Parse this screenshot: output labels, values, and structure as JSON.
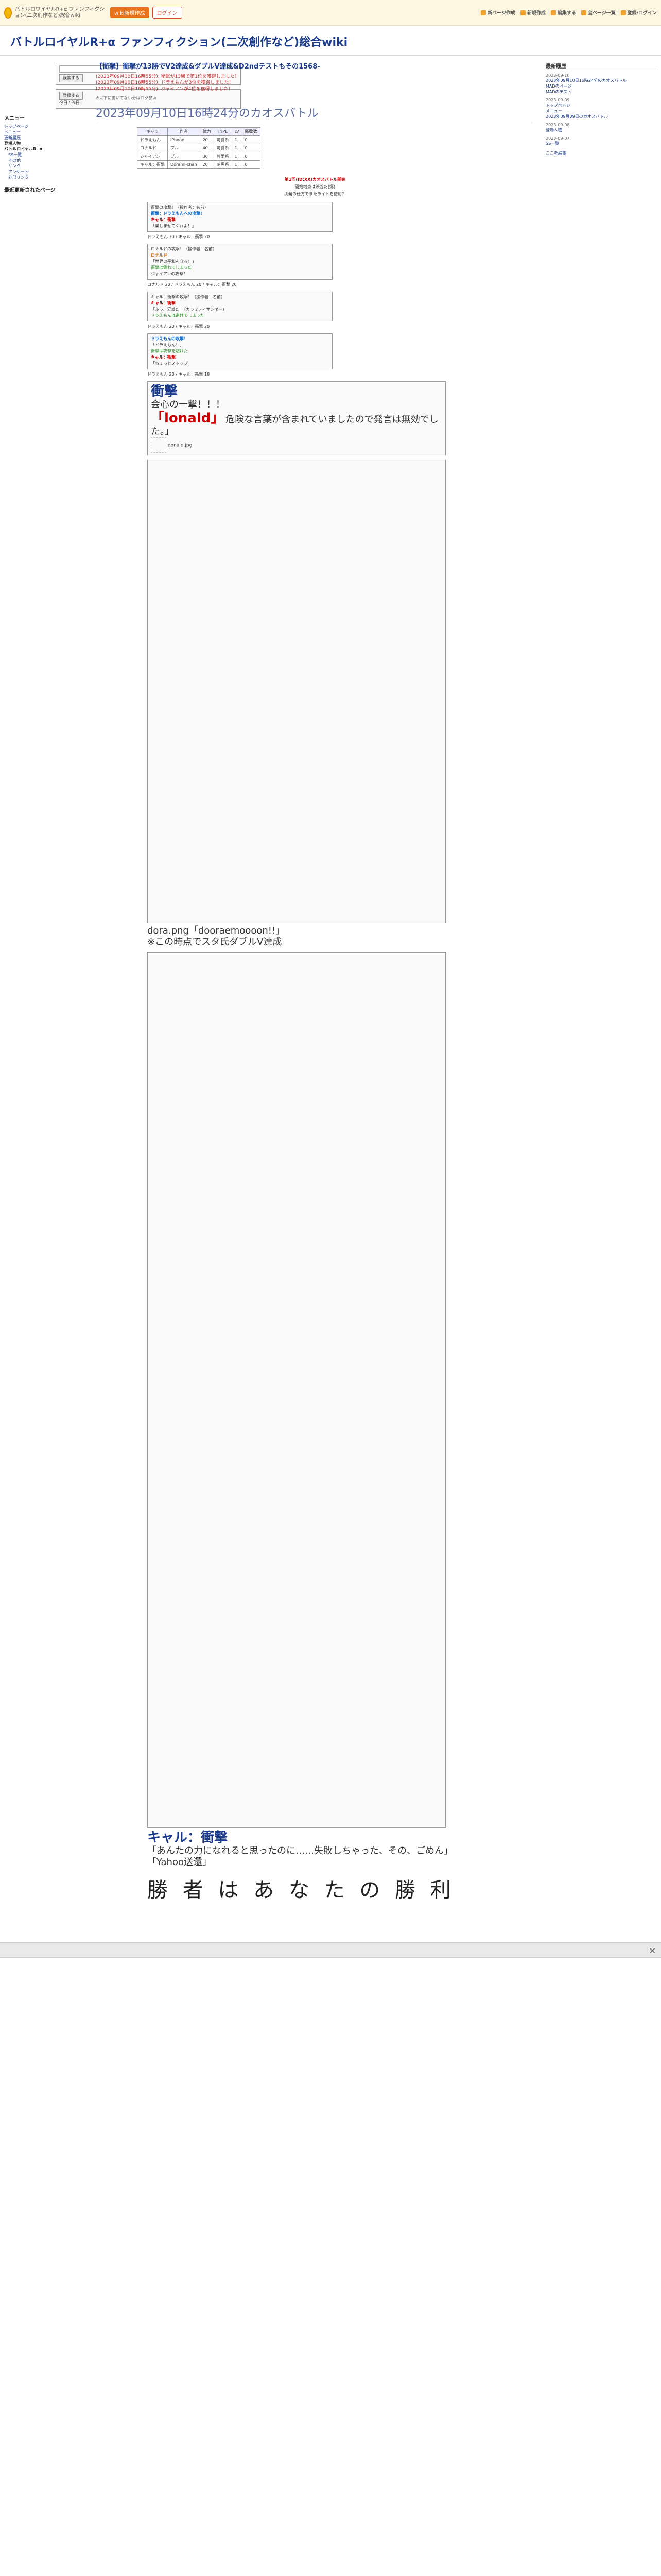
{
  "site": {
    "logo_text": "バトルロワイヤルR+α ファンフィクション(二次創作など)総合wiki",
    "btn_new": "wiki新規作成",
    "btn_login": "ログイン",
    "menu": [
      "新ページ作成",
      "新規作成",
      "編集する",
      "全ページ一覧",
      "登録/ログイン"
    ]
  },
  "wiki_title": "バトルロイヤルR+α ファンフィクション(二次創作など)総合wiki",
  "sidebar": {
    "search_placeholder": "",
    "search_btn": "検索する",
    "register_btn": "登録する",
    "today": "今日 / 昨日",
    "menu_title": "メニュー",
    "items": [
      "トップページ",
      "メニュー",
      "更新履歴",
      "登場人物",
      "バトルロイヤルR+α",
      "SS一覧",
      "その他",
      "リンク",
      "アンケート",
      "外部リンク"
    ],
    "recent_title": "最近更新されたページ"
  },
  "page": {
    "header": "【衝撃】衝撃が13勝でV2達成&ダブルV達成&D2ndテストもその1568-",
    "updates": [
      "(2023年09月10日16時55分): 衝撃が13勝で第1位を獲得しました！",
      "(2023年09月10日16時55分): ドラえもんが3位を獲得しました！",
      "(2023年09月10日16時55分): ジャイアンが4位を獲得しました！"
    ],
    "note": "※以下に書いてない分はログ参照",
    "big_title": "2023年09月10日16時24分のカオスバトル"
  },
  "stats": {
    "headers": [
      "キャラ",
      "作者",
      "体力",
      "TYPE",
      "LV",
      "勝敗数"
    ],
    "rows": [
      [
        "ドラえもん",
        "iPhone",
        "20",
        "可愛系",
        "1",
        "0"
      ],
      [
        "ロナルド",
        "ブル",
        "40",
        "可愛系",
        "1",
        "0"
      ],
      [
        "ジャイアン",
        "ブル",
        "30",
        "可愛系",
        "1",
        "0"
      ],
      [
        "キャル：衝撃",
        "Dorami-chan",
        "20",
        "暗黒系",
        "1",
        "0"
      ]
    ]
  },
  "intro": [
    "第1回(ID:XX)カオスバトル開始",
    "開始地点は渋谷だ(爆)",
    "挑発の仕方でまたライトを使用？"
  ],
  "blocks": [
    {
      "lines": [
        "衝撃の攻撃！（操作者：名前）",
        "衝撃：ドラえもんへの攻撃！",
        "キャル：衝撃",
        "「楽しませてくれよ！」"
      ],
      "dmg": "ドラえもん 20 / キャル：衝撃 20"
    },
    {
      "lines": [
        "ロナルドの攻撃！（操作者：名前）",
        "ロナルド",
        "「世界の平和を守る！」",
        "衝撃は倒れてしまった",
        "ジャイアンの攻撃！"
      ],
      "dmg": "ロナルド 20 / ドラえもん 20 / キャル：衝撃 20"
    },
    {
      "lines": [
        "キャル：衝撃の攻撃！（操作者：名前）",
        "キャル：衝撃",
        "「ふっ、冗談だ」（カラミティサンダー）",
        "ドラえもんは避けてしまった"
      ],
      "dmg": "ドラえもん 20 / キャル：衝撃 20"
    },
    {
      "lines": [
        "ドラえもんの攻撃！",
        "「ドラえもん！」",
        "衝撃は攻撃を避けた",
        "キャル：衝撃",
        "「ちょっとストップ」"
      ],
      "dmg": "ドラえもん 20 / キャル：衝撃 18"
    }
  ],
  "special": {
    "big_name": "衝撃",
    "big_line": "会心の一撃！！！",
    "red_name": "「lonald」",
    "red_line": "危険な言葉が含まれていましたので発言は無効でした。」",
    "img_caption": "donald.jpg",
    "dora_line": "dora.png「dooraemoooon!!」",
    "dora_note": "※この時点でスタ氏ダブルV達成",
    "cal_line": "キャル：衝撃",
    "cal_quote": "「あんたの力になれると思ったのに……失敗しちゃった、その、ごめん」",
    "yahoo": "「Yahoo送還」",
    "end_text": "勝 者 は あ な た の 勝 利"
  },
  "right": {
    "title": "最新履歴",
    "dates": [
      "2023-09-10",
      "2023-09-09",
      "2023-09-08",
      "2023-09-07"
    ],
    "items": [
      "2023年09月10日16時24分のカオスバトル",
      "MADのページ",
      "MADのテスト",
      "トップページ",
      "メニュー",
      "2023年09月09日のカオスバトル",
      "登場人物",
      "SS一覧"
    ],
    "footer": "ここを編集"
  },
  "colors": {
    "accent": "#1a3a8c",
    "alert": "#c03030",
    "topbar": "#fdf7e2"
  }
}
